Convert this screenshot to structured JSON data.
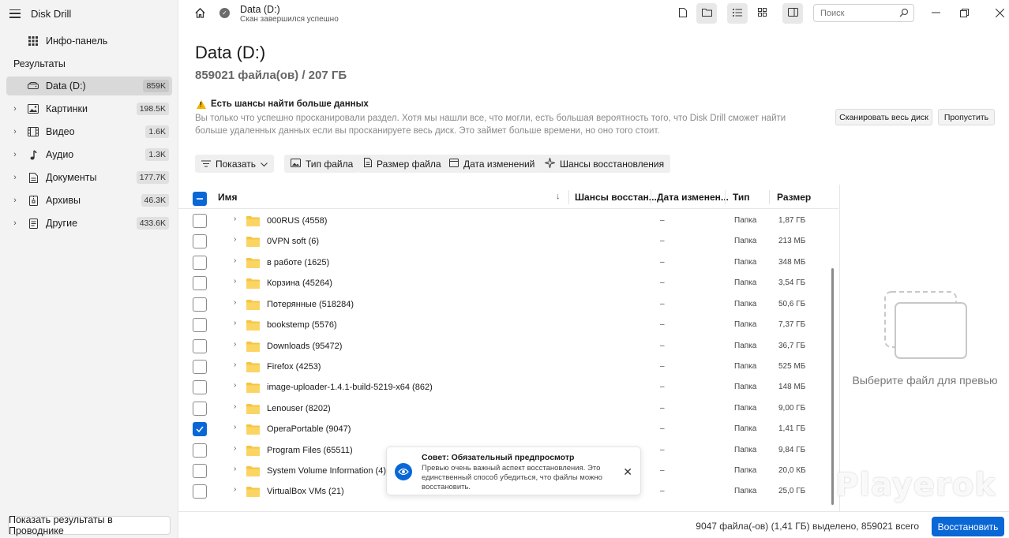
{
  "app": {
    "title": "Disk Drill"
  },
  "sidebar": {
    "dashboard_label": "Инфо-панель",
    "section_title": "Результаты",
    "items": [
      {
        "label": "Data (D:)",
        "count": "859K",
        "icon": "drive-icon"
      },
      {
        "label": "Картинки",
        "count": "198.5K",
        "icon": "image-icon"
      },
      {
        "label": "Видео",
        "count": "1.6K",
        "icon": "video-icon"
      },
      {
        "label": "Аудио",
        "count": "1.3K",
        "icon": "music-icon"
      },
      {
        "label": "Документы",
        "count": "177.7K",
        "icon": "document-icon"
      },
      {
        "label": "Архивы",
        "count": "46.3K",
        "icon": "archive-icon"
      },
      {
        "label": "Другие",
        "count": "433.6K",
        "icon": "other-file-icon"
      }
    ],
    "explorer_button": "Показать результаты в Проводнике"
  },
  "header": {
    "title": "Data (D:)",
    "subtitle": "Скан завершился успешно",
    "search_placeholder": "Поиск"
  },
  "main": {
    "title": "Data (D:)",
    "subtitle": "859021 файла(ов) / 207 ГБ",
    "warning_title": "Есть шансы найти больше данных",
    "warning_text": "Вы только что успешно просканировали раздел. Хотя мы нашли все, что могли, есть большая вероятность того, что Disk Drill сможет найти больше удаленных данных если вы просканируете весь диск. Это займет больше времени, но оно того стоит.",
    "scan_disk_button": "Сканировать весь диск",
    "skip_button": "Пропустить",
    "filters": {
      "show": "Показать",
      "file_type": "Тип файла",
      "file_size": "Размер файла",
      "date_modified": "Дата изменений",
      "recovery_chances": "Шансы восстановления"
    }
  },
  "table": {
    "headers": {
      "name": "Имя",
      "chances": "Шансы восстан...",
      "date": "Дата изменен...",
      "type": "Тип",
      "size": "Размер"
    },
    "rows": [
      {
        "name": "000RUS (4558)",
        "date": "–",
        "type": "Папка",
        "size": "1,87 ГБ",
        "checked": false
      },
      {
        "name": "0VPN soft (6)",
        "date": "–",
        "type": "Папка",
        "size": "213 МБ",
        "checked": false
      },
      {
        "name": "в работе (1625)",
        "date": "–",
        "type": "Папка",
        "size": "348 МБ",
        "checked": false
      },
      {
        "name": "Корзина (45264)",
        "date": "–",
        "type": "Папка",
        "size": "3,54 ГБ",
        "checked": false
      },
      {
        "name": "Потерянные (518284)",
        "date": "–",
        "type": "Папка",
        "size": "50,6 ГБ",
        "checked": false
      },
      {
        "name": "bookstemp (5576)",
        "date": "–",
        "type": "Папка",
        "size": "7,37 ГБ",
        "checked": false
      },
      {
        "name": "Downloads (95472)",
        "date": "–",
        "type": "Папка",
        "size": "36,7 ГБ",
        "checked": false
      },
      {
        "name": "Firefox (4253)",
        "date": "–",
        "type": "Папка",
        "size": "525 МБ",
        "checked": false
      },
      {
        "name": "image-uploader-1.4.1-build-5219-x64 (862)",
        "date": "–",
        "type": "Папка",
        "size": "148 МБ",
        "checked": false
      },
      {
        "name": "Lenouser (8202)",
        "date": "–",
        "type": "Папка",
        "size": "9,00 ГБ",
        "checked": false
      },
      {
        "name": "OperaPortable (9047)",
        "date": "–",
        "type": "Папка",
        "size": "1,41 ГБ",
        "checked": true
      },
      {
        "name": "Program Files (65511)",
        "date": "–",
        "type": "Папка",
        "size": "9,84 ГБ",
        "checked": false
      },
      {
        "name": "System Volume Information (4)",
        "date": "–",
        "type": "Папка",
        "size": "20,0 КБ",
        "checked": false
      },
      {
        "name": "VirtualBox VMs (21)",
        "date": "–",
        "type": "Папка",
        "size": "25,0 ГБ",
        "checked": false
      }
    ]
  },
  "preview": {
    "placeholder": "Выберите файл для превью"
  },
  "toast": {
    "title": "Совет: Обязательный предпросмотр",
    "body": "Превью очень важный аспект восстановления. Это единственный способ убедиться, что файлы можно восстановить."
  },
  "footer": {
    "status": "9047 файла(-ов) (1,41 ГБ) выделено, 859021 всего",
    "restore_button": "Восстановить"
  },
  "watermark": "Playerok",
  "colors": {
    "accent": "#0a67d6",
    "warning": "#f2b500",
    "folder": "#f5c542"
  }
}
